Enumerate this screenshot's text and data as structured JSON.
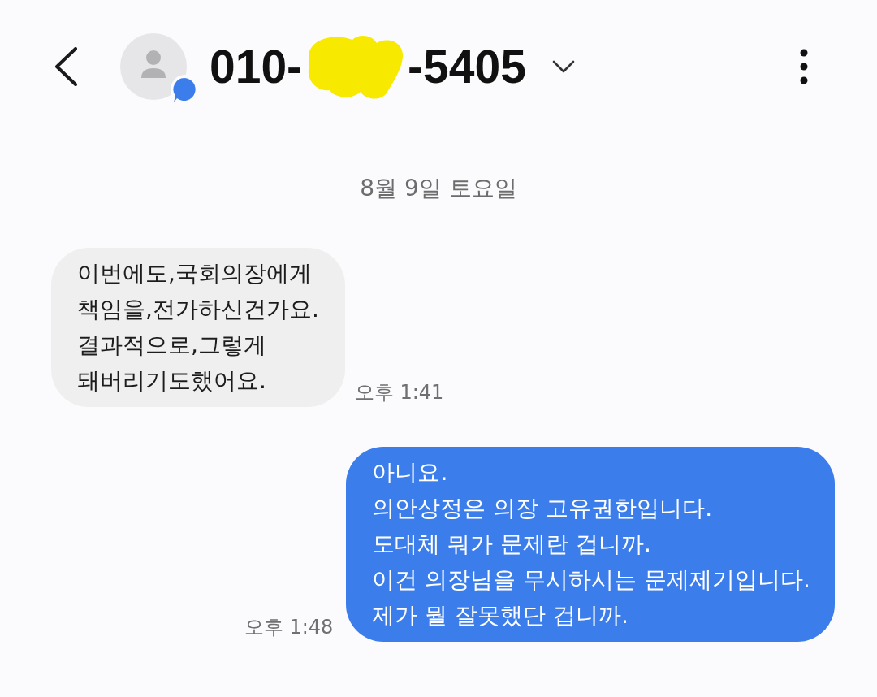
{
  "header": {
    "number_parts": [
      "010-",
      "-5405"
    ]
  },
  "date_divider": "8월 9일 토요일",
  "messages": [
    {
      "kind": "incoming",
      "text": "이번에도,국회의장에게\n책임을,전가하신건가요.\n결과적으로,그렇게\n돼버리기도했어요.",
      "time": "오후 1:41"
    },
    {
      "kind": "outgoing",
      "text": "아니요.\n의안상정은 의장 고유권한입니다.\n도대체 뭐가 문제란 겁니까.\n이건 의장님을 무시하시는 문제제기입니다.\n제가 뭘 잘못했단 겁니까.",
      "time": "오후 1:48"
    }
  ]
}
